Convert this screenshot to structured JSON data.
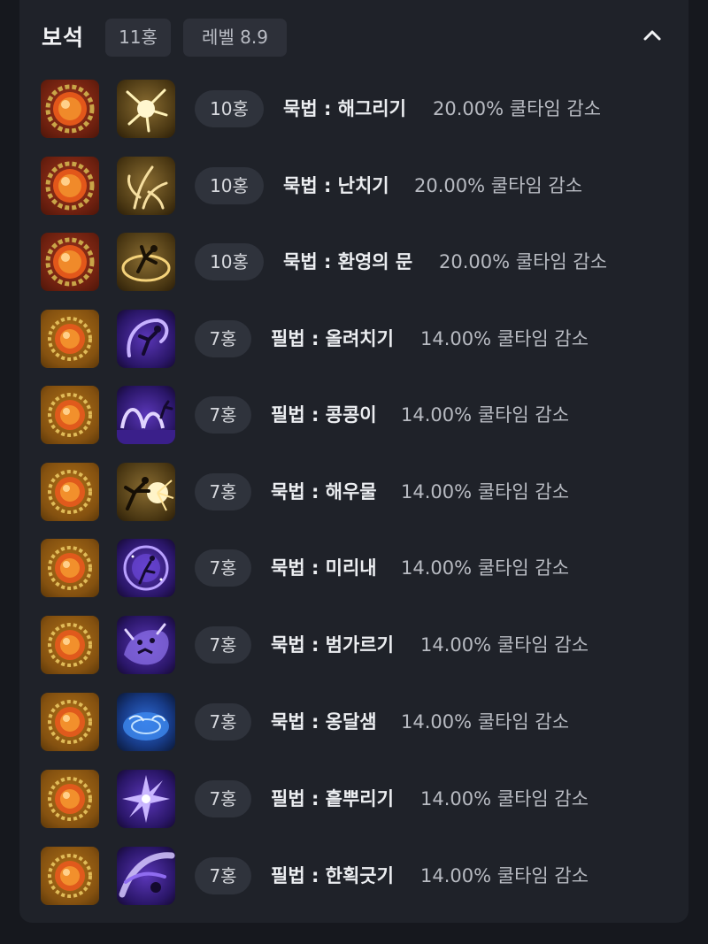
{
  "section": {
    "title": "보석",
    "count_chip": "11홍",
    "level_chip": "레벨 8.9",
    "collapse_icon": "chevron-up-icon"
  },
  "gems": [
    {
      "tier": "10홍",
      "skill": "묵법 : 해그리기",
      "effect": "20.00% 쿨타임 감소",
      "gem_icon": "tier10-gem-icon",
      "skill_icon": "skill-burst-icon",
      "skill_color": "gold"
    },
    {
      "tier": "10홍",
      "skill": "묵법 : 난치기",
      "effect": "20.00% 쿨타임 감소",
      "gem_icon": "tier10-gem-icon",
      "skill_icon": "skill-orchid-icon",
      "skill_color": "gold"
    },
    {
      "tier": "10홍",
      "skill": "묵법 : 환영의 문",
      "effect": "20.00% 쿨타임 감소",
      "gem_icon": "tier10-gem-icon",
      "skill_icon": "skill-portal-icon",
      "skill_color": "gold"
    },
    {
      "tier": "7홍",
      "skill": "필법 : 올려치기",
      "effect": "14.00% 쿨타임 감소",
      "gem_icon": "tier7-gem-icon",
      "skill_icon": "skill-uppercut-icon",
      "skill_color": "purple"
    },
    {
      "tier": "7홍",
      "skill": "필법 : 콩콩이",
      "effect": "14.00% 쿨타임 감소",
      "gem_icon": "tier7-gem-icon",
      "skill_icon": "skill-hop-icon",
      "skill_color": "purple"
    },
    {
      "tier": "7홍",
      "skill": "묵법 : 해우물",
      "effect": "14.00% 쿨타임 감소",
      "gem_icon": "tier7-gem-icon",
      "skill_icon": "skill-strike-icon",
      "skill_color": "gold"
    },
    {
      "tier": "7홍",
      "skill": "묵법 : 미리내",
      "effect": "14.00% 쿨타임 감소",
      "gem_icon": "tier7-gem-icon",
      "skill_icon": "skill-galaxy-icon",
      "skill_color": "purple"
    },
    {
      "tier": "7홍",
      "skill": "묵법 : 범가르기",
      "effect": "14.00% 쿨타임 감소",
      "gem_icon": "tier7-gem-icon",
      "skill_icon": "skill-tiger-icon",
      "skill_color": "purple"
    },
    {
      "tier": "7홍",
      "skill": "묵법 : 옹달샘",
      "effect": "14.00% 쿨타임 감소",
      "gem_icon": "tier7-gem-icon",
      "skill_icon": "skill-spring-icon",
      "skill_color": "blue"
    },
    {
      "tier": "7홍",
      "skill": "필법 : 흩뿌리기",
      "effect": "14.00% 쿨타임 감소",
      "gem_icon": "tier7-gem-icon",
      "skill_icon": "skill-scatter-icon",
      "skill_color": "purple"
    },
    {
      "tier": "7홍",
      "skill": "필법 : 한획긋기",
      "effect": "14.00% 쿨타임 감소",
      "gem_icon": "tier7-gem-icon",
      "skill_icon": "skill-stroke-icon",
      "skill_color": "purple"
    }
  ]
}
